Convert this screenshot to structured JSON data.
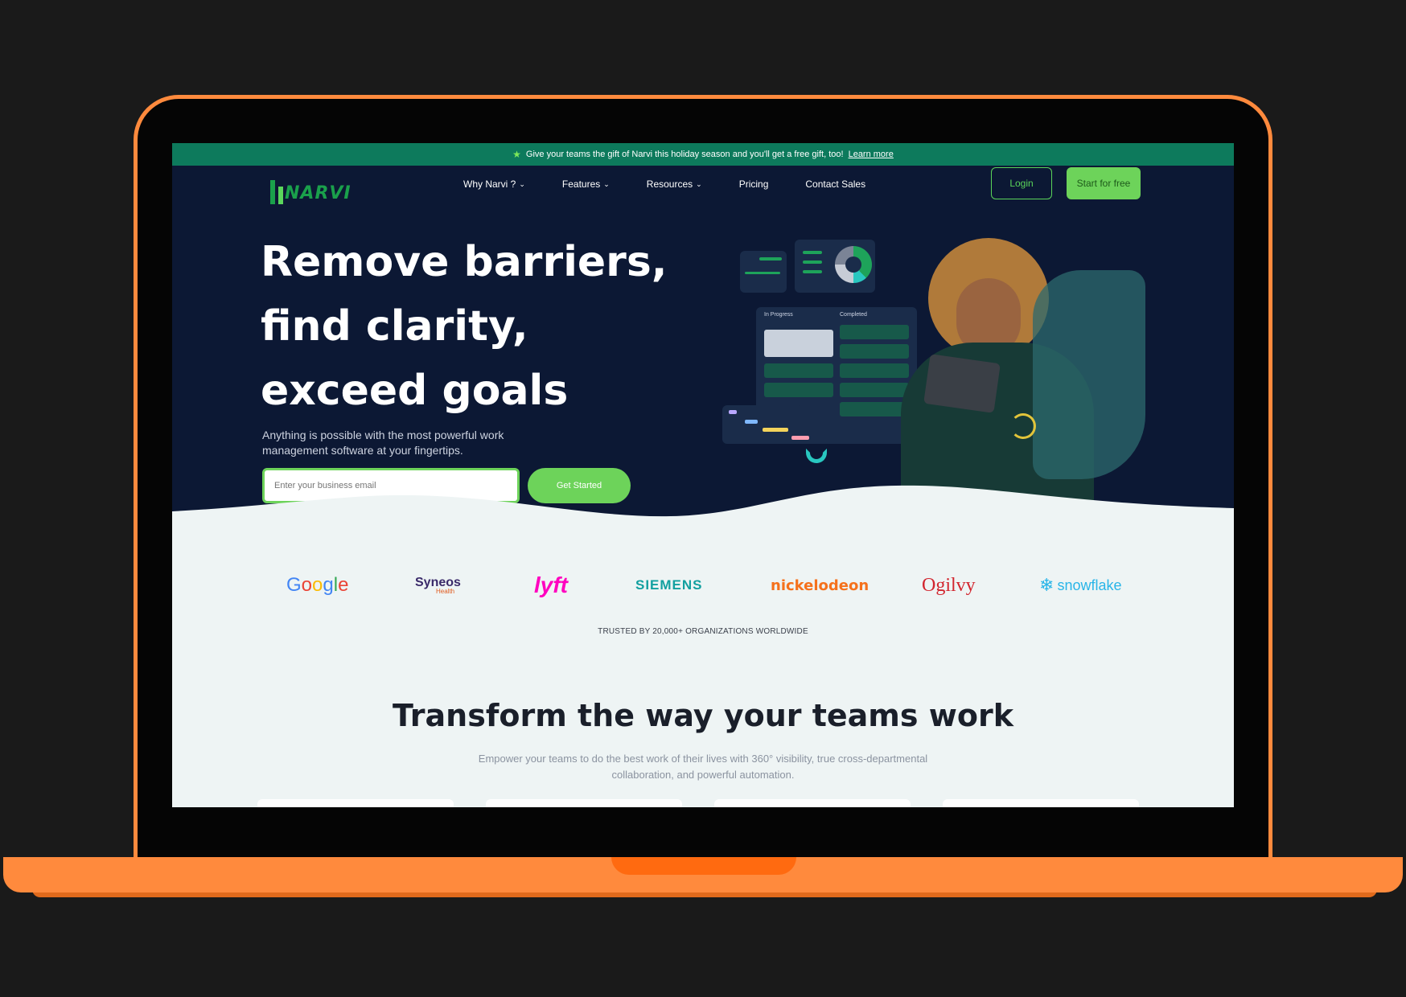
{
  "promo": {
    "text": "Give your teams the gift of Narvi this holiday season and you'll get a free gift, too!",
    "link": "Learn more"
  },
  "brand": {
    "logo_text": "NARVI",
    "accent": "#6dd35a",
    "dark_bg": "#0c1834",
    "promo_bg": "#0d7a5c",
    "laptop_frame": "#ff8a3d"
  },
  "nav": {
    "items": [
      {
        "label": "Why Narvi ?",
        "dropdown": true
      },
      {
        "label": "Features",
        "dropdown": true
      },
      {
        "label": "Resources",
        "dropdown": true
      },
      {
        "label": "Pricing",
        "dropdown": false
      },
      {
        "label": "Contact Sales",
        "dropdown": false
      }
    ],
    "login": "Login",
    "start": "Start for free"
  },
  "hero": {
    "title_lines": [
      "Remove barriers,",
      "find clarity,",
      "exceed goals"
    ],
    "subtitle": "Anything is possible with the most powerful work management software at your fingertips.",
    "email_placeholder": "Enter your business email",
    "cta": "Get Started"
  },
  "illustration": {
    "board_columns": [
      "In Progress",
      "Completed"
    ],
    "donut_labels": [
      "38%",
      "12%",
      "25%",
      "25%"
    ]
  },
  "logos": {
    "brands": [
      "Google",
      "Syneos",
      "lyft",
      "SIEMENS",
      "nickelodeon",
      "Ogilvy",
      "snowflake"
    ],
    "syneos_sub": "Health",
    "trusted": "TRUSTED BY 20,000+ ORGANIZATIONS WORLDWIDE"
  },
  "section": {
    "title": "Transform the way your teams work",
    "subtitle": "Empower your teams to do the best work of their lives with 360° visibility, true cross-departmental collaboration, and powerful automation."
  }
}
